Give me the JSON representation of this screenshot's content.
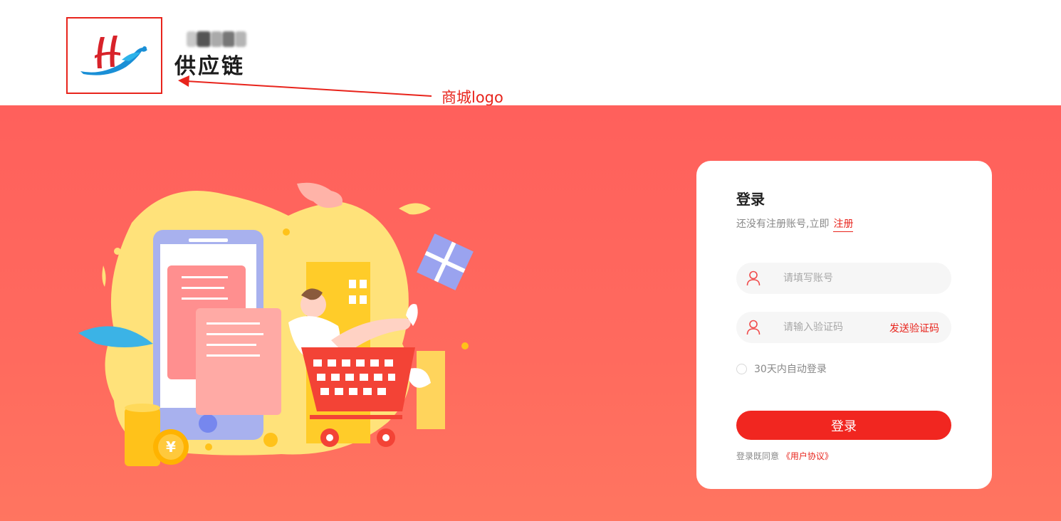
{
  "header": {
    "brand_name": "供应链",
    "annotation": "商城logo"
  },
  "login": {
    "title": "登录",
    "register_prompt": "还没有注册账号,立即",
    "register_link": "注册",
    "account_placeholder": "请填写账号",
    "code_placeholder": "请输入验证码",
    "send_code": "发送验证码",
    "remember_label": "30天内自动登录",
    "submit_label": "登录",
    "agree_prefix": "登录既同意",
    "agree_link": "《用户协议》"
  },
  "colors": {
    "accent": "#f12620",
    "banner": "#ff605c",
    "annotation": "#e8241c"
  },
  "icons": {
    "user": "user-icon",
    "logo": "logo-mark"
  }
}
